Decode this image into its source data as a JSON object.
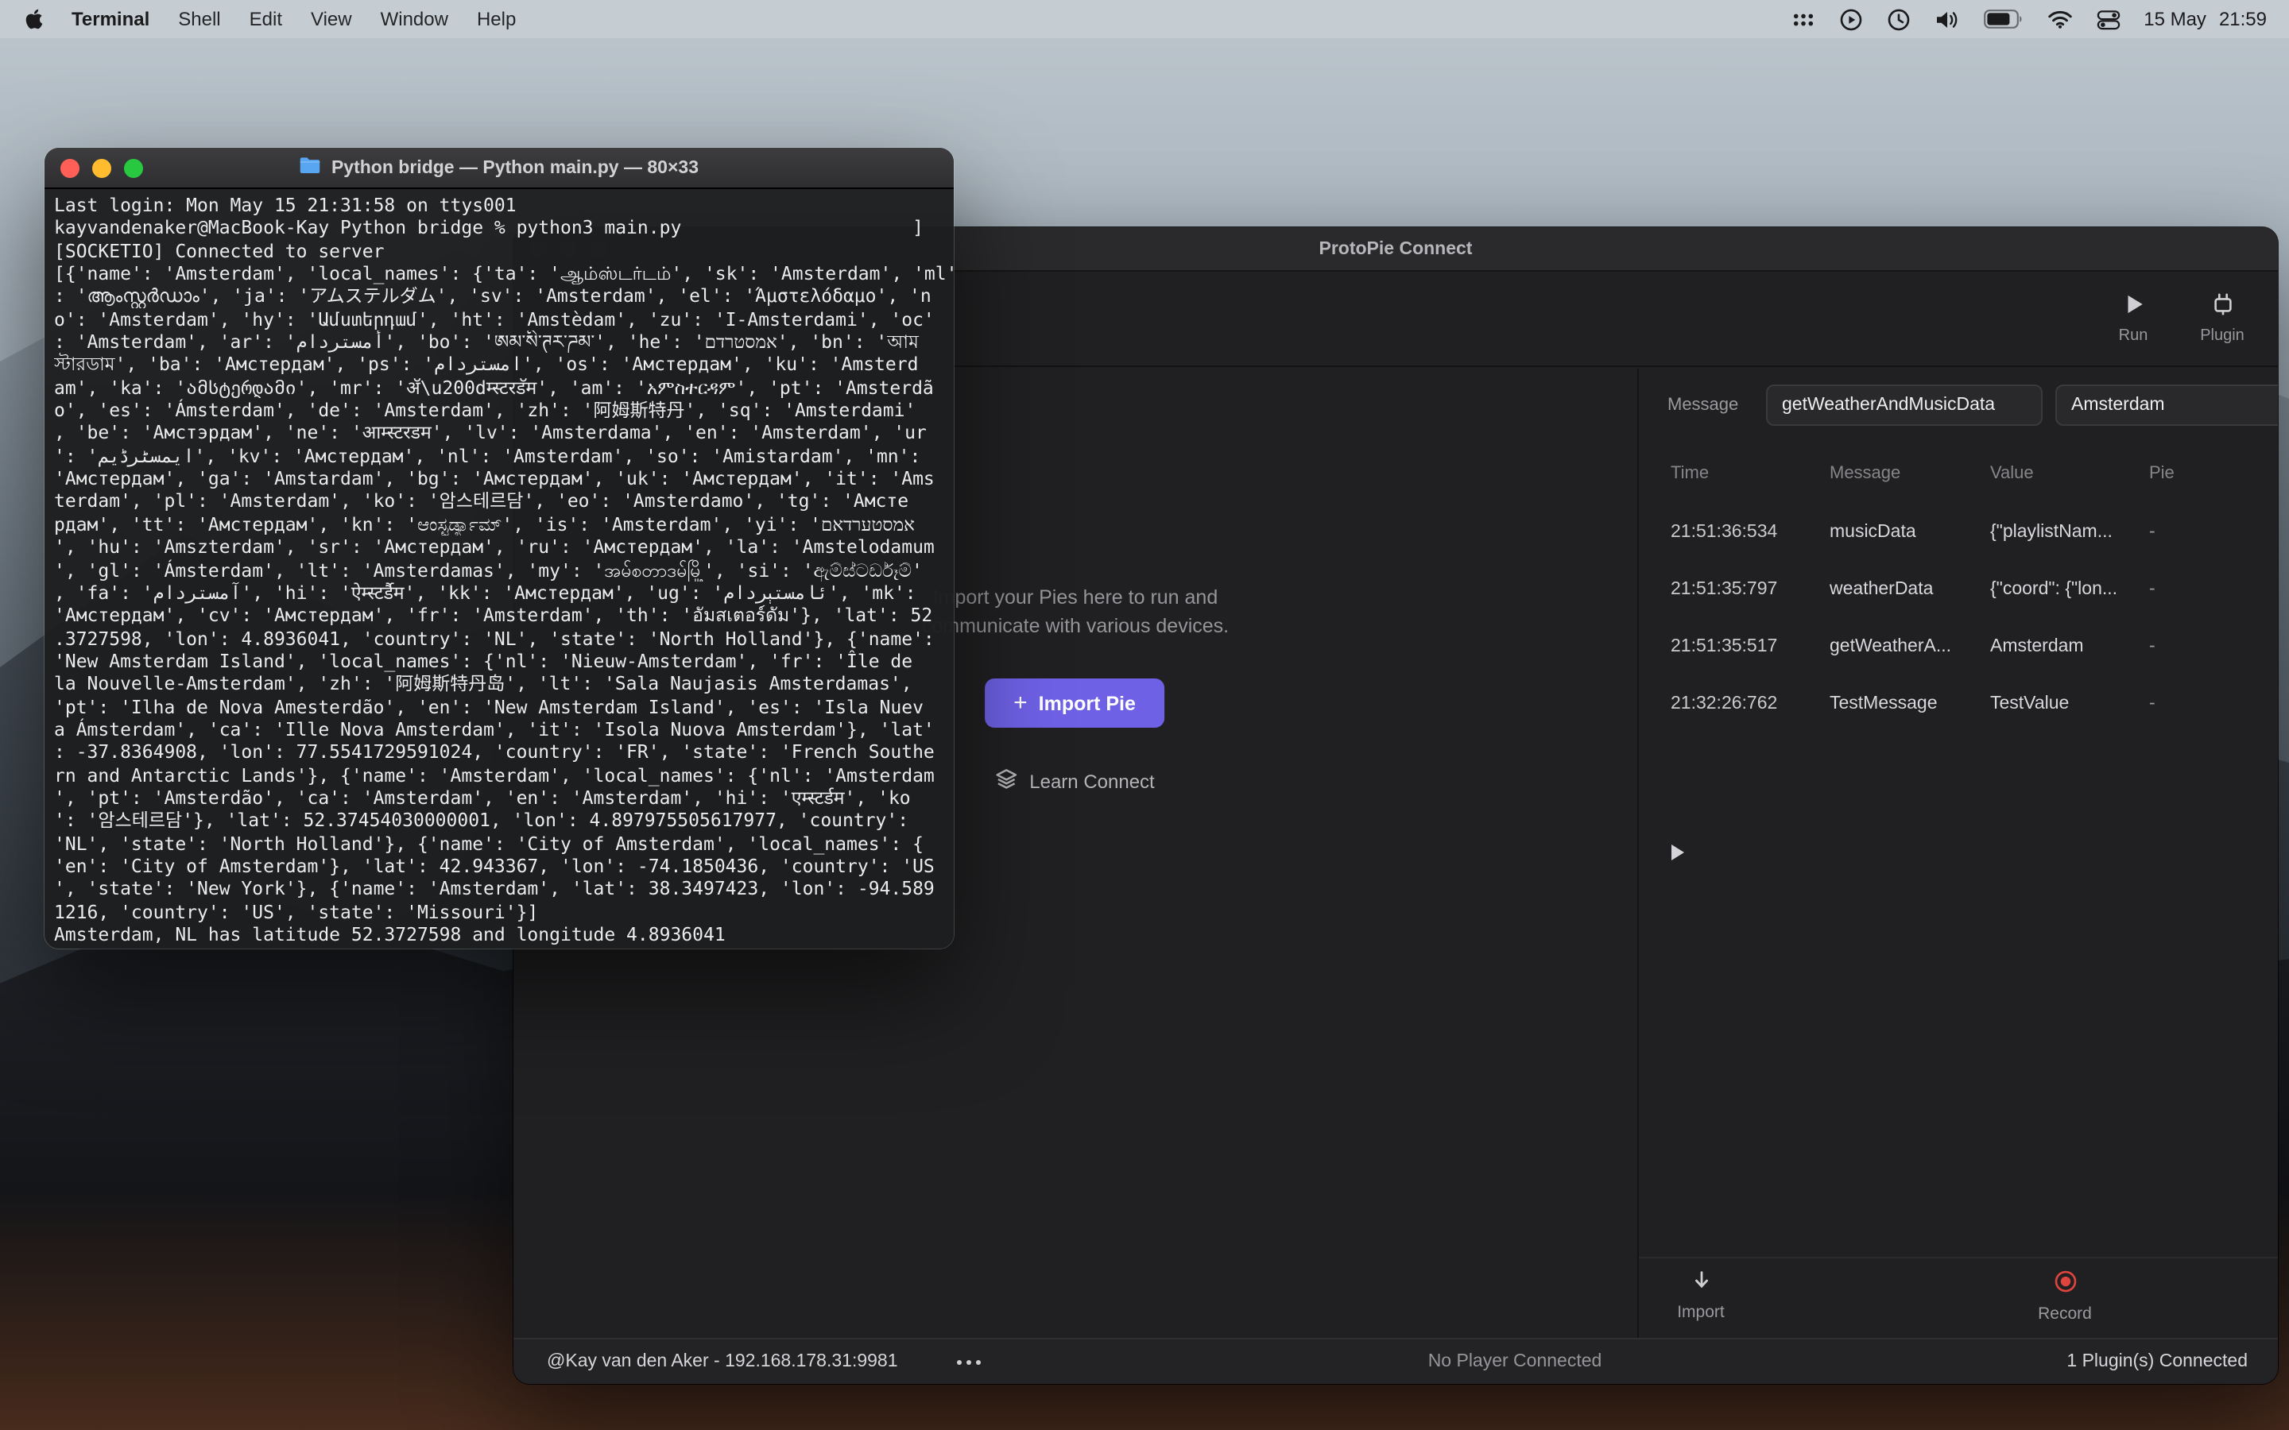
{
  "menu_bar": {
    "app_name": "Terminal",
    "items": [
      "Shell",
      "Edit",
      "View",
      "Window",
      "Help"
    ],
    "status": {
      "date": "15 May",
      "time": "21:59"
    }
  },
  "terminal": {
    "title": "Python bridge — Python main.py — 80×33",
    "lines": [
      "Last login: Mon May 15 21:31:58 on ttys001",
      "kayvandenaker@MacBook-Kay Python bridge % python3 main.py                     ]",
      "[SOCKETIO] Connected to server",
      "[{'name': 'Amsterdam', 'local_names': {'ta': 'ஆம்ஸ்டர்டம்', 'sk': 'Amsterdam', 'ml'",
      ": 'ആംസ്റ്റർഡാം', 'ja': 'アムステルダム', 'sv': 'Amsterdam', 'el': 'Άμστελόδαμο', 'n",
      "o': 'Amsterdam', 'hy': 'Ամստերդամ', 'ht': 'Amstèdam', 'zu': 'I-Amsterdami', 'oc'",
      ": 'Amsterdam', 'ar': 'أمستردام', 'bo': 'ཨམ་སི་ཊར་ཌམ་', 'he': 'אמסטרדם', 'bn': 'আম",
      "স্টারডাম', 'ba': 'Амстердам', 'ps': 'امستردام', 'os': 'Амстердам', 'ku': 'Amsterd",
      "am', 'ka': 'ამსტერდამი', 'mr': 'ॲ\\u200dम्स्टरडॅम', 'am': 'አምስተርዳም', 'pt': 'Amsterdã",
      "o', 'es': 'Ámsterdam', 'de': 'Amsterdam', 'zh': '阿姆斯特丹', 'sq': 'Amsterdami'",
      ", 'be': 'Амстэрдам', 'ne': 'आम्स्टरडम', 'lv': 'Amsterdama', 'en': 'Amsterdam', 'ur",
      "': 'ایمسٹرڈیم', 'kv': 'Амстердам', 'nl': 'Amsterdam', 'so': 'Amistardam', 'mn':",
      "'Амстердам', 'ga': 'Amstardam', 'bg': 'Амстердам', 'uk': 'Амстердам', 'it': 'Ams",
      "terdam', 'pl': 'Amsterdam', 'ko': '암스테르담', 'eo': 'Amsterdamo', 'tg': 'Амсте",
      "рдам', 'tt': 'Амстердам', 'kn': 'ಆಂಸ್ಟರ್ಡ್ಯಾಮ್', 'is': 'Amsterdam', 'yi': 'אמסטערדאם",
      "', 'hu': 'Amszterdam', 'sr': 'Амстердам', 'ru': 'Амстердам', 'la': 'Amstelodamum",
      "', 'gl': 'Ámsterdam', 'lt': 'Amsterdamas', 'my': 'အမ်စတာဒမ်မြို့', 'si': 'ඇම්ස්ටර්ඩෑම්'",
      ", 'fa': 'آمستردام', 'hi': 'ऐम्स्टर्डैम', 'kk': 'Амстердам', 'ug': 'ئامستېردام', 'mk':",
      "'Амстердам', 'cv': 'Амстердам', 'fr': 'Amsterdam', 'th': 'อัมสเตอร์ดัม'}, 'lat': 52",
      ".3727598, 'lon': 4.8936041, 'country': 'NL', 'state': 'North Holland'}, {'name':",
      "'New Amsterdam Island', 'local_names': {'nl': 'Nieuw-Amsterdam', 'fr': 'Île de",
      "la Nouvelle-Amsterdam', 'zh': '阿姆斯特丹岛', 'lt': 'Sala Naujasis Amsterdamas',",
      "'pt': 'Ilha de Nova Amesterdão', 'en': 'New Amsterdam Island', 'es': 'Isla Nuev",
      "a Ámsterdam', 'ca': 'Ille Nova Amsterdam', 'it': 'Isola Nuova Amsterdam'}, 'lat'",
      ": -37.8364908, 'lon': 77.5541729591024, 'country': 'FR', 'state': 'French Southe",
      "rn and Antarctic Lands'}, {'name': 'Amsterdam', 'local_names': {'nl': 'Amsterdam",
      "', 'pt': 'Amsterdão', 'ca': 'Amsterdam', 'en': 'Amsterdam', 'hi': 'एम्स्टर्डम', 'ko",
      "': '암스테르담'}, 'lat': 52.37454030000001, 'lon': 4.897975505617977, 'country':",
      "'NL', 'state': 'North Holland'}, {'name': 'City of Amsterdam', 'local_names': {",
      "'en': 'City of Amsterdam'}, 'lat': 42.943367, 'lon': -74.1850436, 'country': 'US",
      "', 'state': 'New York'}, {'name': 'Amsterdam', 'lat': 38.3497423, 'lon': -94.589",
      "1216, 'country': 'US', 'state': 'Missouri'}]",
      "Amsterdam, NL has latitude 52.3727598 and longitude 4.8936041"
    ]
  },
  "connect": {
    "title": "ProtoPie Connect",
    "toolbar": {
      "run_label": "Run",
      "plugin_label": "Plugin"
    },
    "message_bar": {
      "label": "Message",
      "message_value": "getWeatherAndMusicData",
      "value_value": "Amsterdam"
    },
    "table": {
      "headers": [
        "Time",
        "Message",
        "Value",
        "Pie"
      ],
      "rows": [
        {
          "time": "21:51:36:534",
          "message": "musicData",
          "value": "{\"playlistNam...",
          "pie": "-"
        },
        {
          "time": "21:51:35:797",
          "message": "weatherData",
          "value": "{\"coord\": {\"lon...",
          "pie": "-"
        },
        {
          "time": "21:51:35:517",
          "message": "getWeatherA...",
          "value": "Amsterdam",
          "pie": "-"
        },
        {
          "time": "21:32:26:762",
          "message": "TestMessage",
          "value": "TestValue",
          "pie": "-"
        }
      ]
    },
    "empty_state": {
      "line1": "Import your Pies here to run and",
      "line2": "communicate with various devices.",
      "import_button_plus": "+",
      "import_button": "Import Pie",
      "learn_link": "Learn Connect"
    },
    "footer_actions": {
      "import_label": "Import",
      "record_label": "Record"
    },
    "status_bar": {
      "left": "@Kay van den Aker - 192.168.178.31:9981",
      "center": "No Player Connected",
      "right": "1 Plugin(s) Connected"
    }
  },
  "icons": {
    "apple": "apple-logo",
    "dots-grid": "menu-extra-dots",
    "play-circle": "circled-play",
    "history": "clock",
    "volume": "speaker-waves",
    "battery": "battery-75",
    "wifi": "wifi-arcs",
    "control-center": "toggle-pills",
    "run": "play-triangle",
    "plugin": "plug",
    "import-pie-plus": "plus",
    "learn-connect": "layers-stack",
    "import": "arrow-down",
    "record": "red-dot-ring",
    "log-play": "play-triangle-small",
    "folder": "blue-folder",
    "more-options": "three-dots"
  },
  "colors": {
    "accent_purple": "#6e61e6",
    "record_red": "#e0443e",
    "traffic_red": "#ff5f57",
    "traffic_yellow": "#febc2e",
    "traffic_green": "#28c840"
  }
}
